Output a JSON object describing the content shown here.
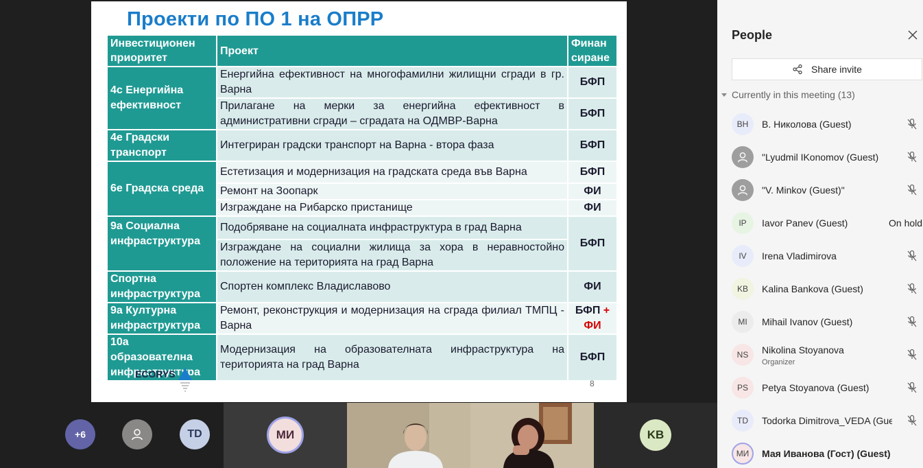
{
  "slide": {
    "title": "Проекти по ПО 1 на ОПРР",
    "headers": [
      "Инвестиционен приоритет",
      "Проект",
      "Финан сиране"
    ],
    "rows": [
      {
        "priority": "4с Енергийна ефективност",
        "project": "Енергийна ефективност на многофамилни жилищни сгради в гр. Варна",
        "funding": "БФП"
      },
      {
        "priority": "",
        "project": "Прилагане на мерки за енергийна ефективност в административни сгради – сградата на ОДМВР-Варна",
        "funding": "БФП"
      },
      {
        "priority": "4е Градски транспорт",
        "project": "Интегриран градски транспорт на Варна - втора фаза",
        "funding": "БФП"
      },
      {
        "priority": "6е Градска среда",
        "project": "Естетизация и модернизация на градската среда във Варна",
        "funding": "БФП"
      },
      {
        "priority": "",
        "project": "Ремонт на Зоопарк",
        "funding": "ФИ"
      },
      {
        "priority": "",
        "project": "Изграждане на Рибарско пристанище",
        "funding": "ФИ"
      },
      {
        "priority": "9а Социална инфраструктура",
        "project": "Подобряване на социалната инфраструктура в град Варна",
        "funding": "БФП"
      },
      {
        "priority": "",
        "project": "Изграждане на социални жилища за хора в неравностойно положение на територията на град Варна",
        "funding": ""
      },
      {
        "priority": "Спортна инфраструктура",
        "project": "Спортен комплекс Владиславово",
        "funding": "ФИ"
      },
      {
        "priority": "9а Културна инфраструктура",
        "project": "Ремонт, реконструкция и модернизация на сграда филиал ТМПЦ - Варна",
        "funding_a": "БФП",
        "funding_plus": "+",
        "funding_b": "ФИ"
      },
      {
        "priority": "10а образователна инфраструктура",
        "project": "Модернизация на образователната инфраструктура на територията на град Варна",
        "funding": "БФП"
      }
    ],
    "logo": "ECORYS",
    "page_number": "8"
  },
  "strip": {
    "overflow_count": "+6",
    "tiles": [
      {
        "initials": "TD"
      },
      {
        "initials": "МИ"
      },
      {
        "initials": "KB"
      }
    ]
  },
  "panel": {
    "title": "People",
    "share_label": "Share invite",
    "section_label": "Currently in this meeting (13)",
    "participants": [
      {
        "initials": "ВН",
        "name": "В. Николова (Guest)",
        "color": "#e8ebfa"
      },
      {
        "initials": "",
        "name": "\"Lyudmil IKonomov (Guest)",
        "color": "#9e9e9e"
      },
      {
        "initials": "",
        "name": "\"V. Minkov (Guest)\"",
        "color": "#9e9e9e"
      },
      {
        "initials": "IP",
        "name": "Iavor Panev (Guest)",
        "status": "On hold",
        "color": "#e7f4e4"
      },
      {
        "initials": "IV",
        "name": "Irena Vladimirova",
        "color": "#e8ebfa"
      },
      {
        "initials": "KB",
        "name": "Kalina Bankova (Guest)",
        "color": "#f0f4e0"
      },
      {
        "initials": "MI",
        "name": "Mihail Ivanov (Guest)",
        "color": "#ececec"
      },
      {
        "initials": "NS",
        "name": "Nikolina Stoyanova",
        "role": "Organizer",
        "color": "#f8e6e6"
      },
      {
        "initials": "PS",
        "name": "Petya Stoyanova (Guest)",
        "color": "#f8e6e6"
      },
      {
        "initials": "TD",
        "name": "Todorka Dimitrova_VEDA (Gue",
        "color": "#e8ebfa"
      },
      {
        "initials": "МИ",
        "name": "Мая Иванова (Гост) (Guest)",
        "color": "#f8e6e6",
        "bold": true
      }
    ]
  }
}
